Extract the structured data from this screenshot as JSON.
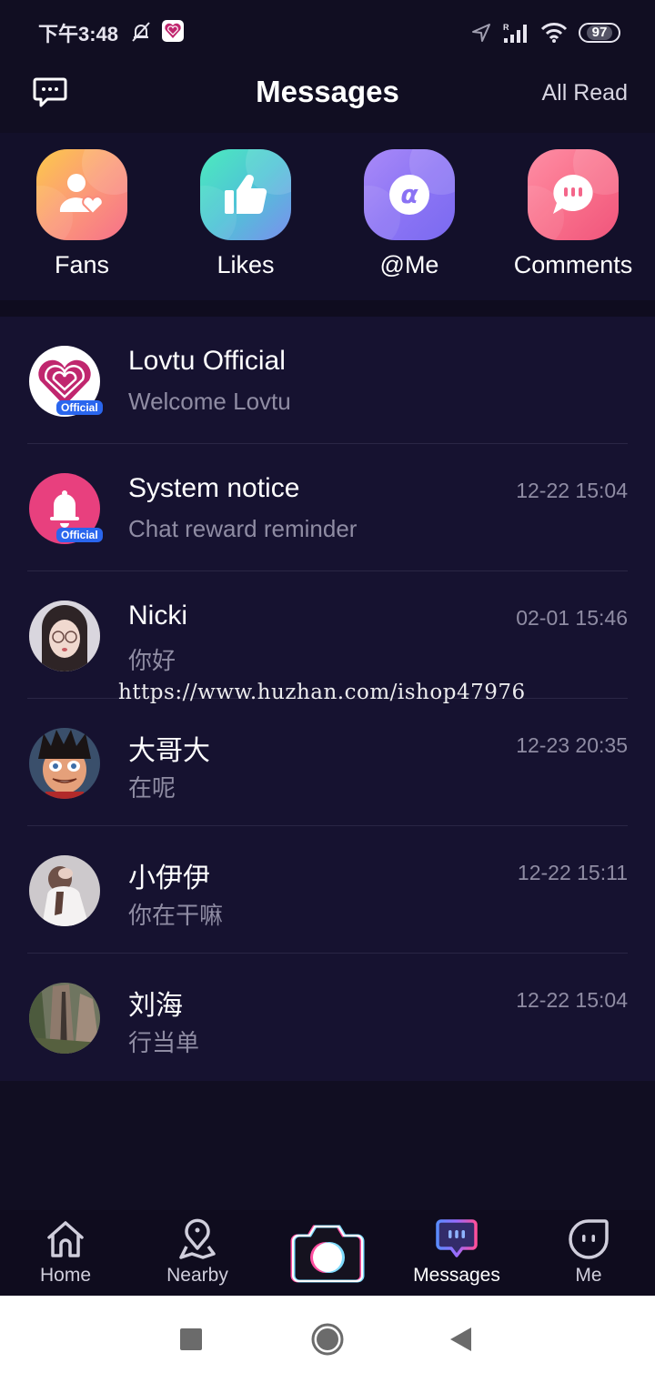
{
  "status_bar": {
    "time": "下午3:48",
    "battery": "97",
    "icons": [
      "mute-bell-icon",
      "lovtu-app-icon",
      "location-icon",
      "signal-roaming-icon",
      "wifi-icon",
      "battery-icon"
    ]
  },
  "header": {
    "title": "Messages",
    "all_read_label": "All Read",
    "left_icon": "chat-bubble-icon"
  },
  "quick_actions": [
    {
      "label": "Fans",
      "icon": "fans-heart-user-icon"
    },
    {
      "label": "Likes",
      "icon": "thumbs-up-icon"
    },
    {
      "label": "@Me",
      "icon": "at-sign-icon"
    },
    {
      "label": "Comments",
      "icon": "comment-bubble-icon"
    }
  ],
  "conversations": [
    {
      "name": "Lovtu Official",
      "preview": "Welcome Lovtu",
      "time": "",
      "badge": "Official",
      "avatar": "lovtu-logo"
    },
    {
      "name": "System notice",
      "preview": "Chat reward reminder",
      "time": "12-22 15:04",
      "badge": "Official",
      "avatar": "bell"
    },
    {
      "name": "Nicki",
      "preview": "你好",
      "time": "02-01 15:46",
      "badge": "",
      "avatar": "photo"
    },
    {
      "name": "大哥大",
      "preview": "在呢",
      "time": "12-23 20:35",
      "badge": "",
      "avatar": "cartoon"
    },
    {
      "name": "小伊伊",
      "preview": "你在干嘛",
      "time": "12-22 15:11",
      "badge": "",
      "avatar": "photo"
    },
    {
      "name": "刘海",
      "preview": "行当单",
      "time": "12-22 15:04",
      "badge": "",
      "avatar": "photo"
    }
  ],
  "watermark": "https://www.huzhan.com/ishop47976",
  "tab_bar": {
    "tabs": [
      {
        "label": "Home",
        "icon": "home-icon"
      },
      {
        "label": "Nearby",
        "icon": "location-pin-icon"
      },
      {
        "label": "",
        "icon": "camera-icon"
      },
      {
        "label": "Messages",
        "icon": "messages-icon",
        "active": true
      },
      {
        "label": "Me",
        "icon": "me-face-icon"
      }
    ]
  },
  "nav_bar": [
    "recents",
    "home",
    "back"
  ],
  "colors": {
    "background": "#110e22",
    "list_background": "#161230",
    "muted_text": "#8f8ca3",
    "official_badge": "#2a66ee"
  }
}
